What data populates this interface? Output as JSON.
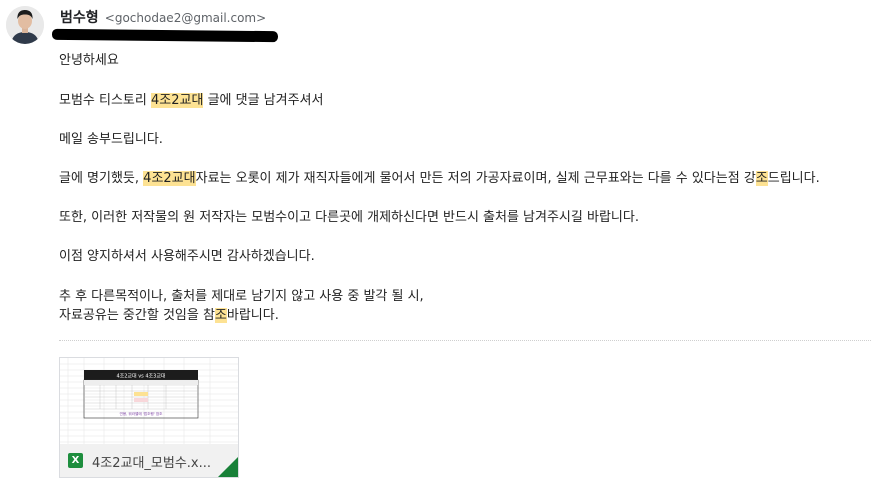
{
  "sender": {
    "name": "범수형",
    "email": "<gochodae2@gmail.com>"
  },
  "body": {
    "p1": "안녕하세요",
    "p2_a": "모범수 티스토리 ",
    "p2_hl": "4조2교대",
    "p2_b": " 글에 댓글 남겨주셔서",
    "p3": "메일 송부드립니다.",
    "p4_a": "글에 명기했듯, ",
    "p4_hl1": "4조2교대",
    "p4_b": "자료는 오롯이 제가 재직자들에게 물어서 만든 저의 가공자료이며, 실제 근무표와는 다를 수 있다는점 강",
    "p4_hl2": "조",
    "p4_c": "드립니다.",
    "p5": "또한, 이러한 저작물의 원 저작자는 모범수이고 다른곳에 개제하신다면 반드시 출처를 남겨주시길 바랍니다.",
    "p6": "이점 양지하셔서 사용해주시면 감사하겠습니다.",
    "p7": "추 후 다른목적이나, 출처를 제대로 남기지 않고 사용 중 발각 될 시,",
    "p8_a": " 자료공유는 중간할 것임을 참",
    "p8_hl": "조",
    "p8_b": "바랍니다."
  },
  "attachment": {
    "file_name": "4조2교대_모범수.x...",
    "icon": "excel-icon",
    "icon_letter": "X",
    "thumb_title": "4조2교대 vs 4조3교대",
    "thumb_note": "연봉, 워라밸에 '법조행' 참조",
    "colors": {
      "excel_green": "#1e8e3e",
      "highlight": "#fde293"
    }
  }
}
